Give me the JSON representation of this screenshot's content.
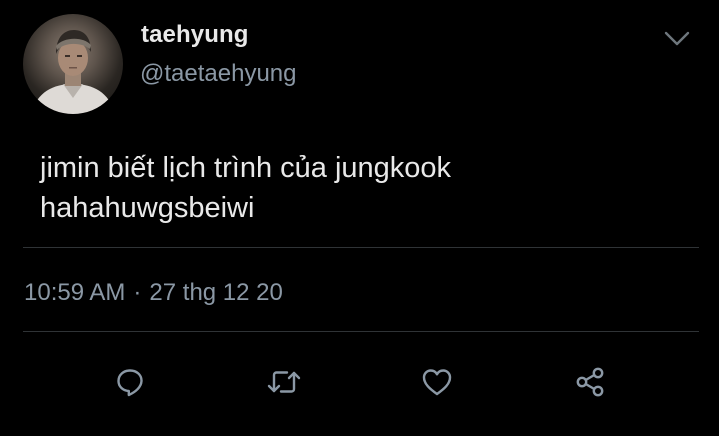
{
  "tweet": {
    "display_name": "taehyung",
    "handle": "@taetaehyung",
    "text": "jimin biết lịch trình của jungkook\nhahahuwgsbeiwi",
    "time": "10:59 AM",
    "separator": "·",
    "date": "27 thg 12 20"
  },
  "icons": {
    "caret": "chevron-down-icon",
    "reply": "reply-icon",
    "retweet": "retweet-icon",
    "like": "heart-icon",
    "share": "share-icon"
  },
  "colors": {
    "background": "#000000",
    "primary_text": "#e9e9e9",
    "secondary_text": "#8b98a5",
    "divider": "#2f3336"
  }
}
